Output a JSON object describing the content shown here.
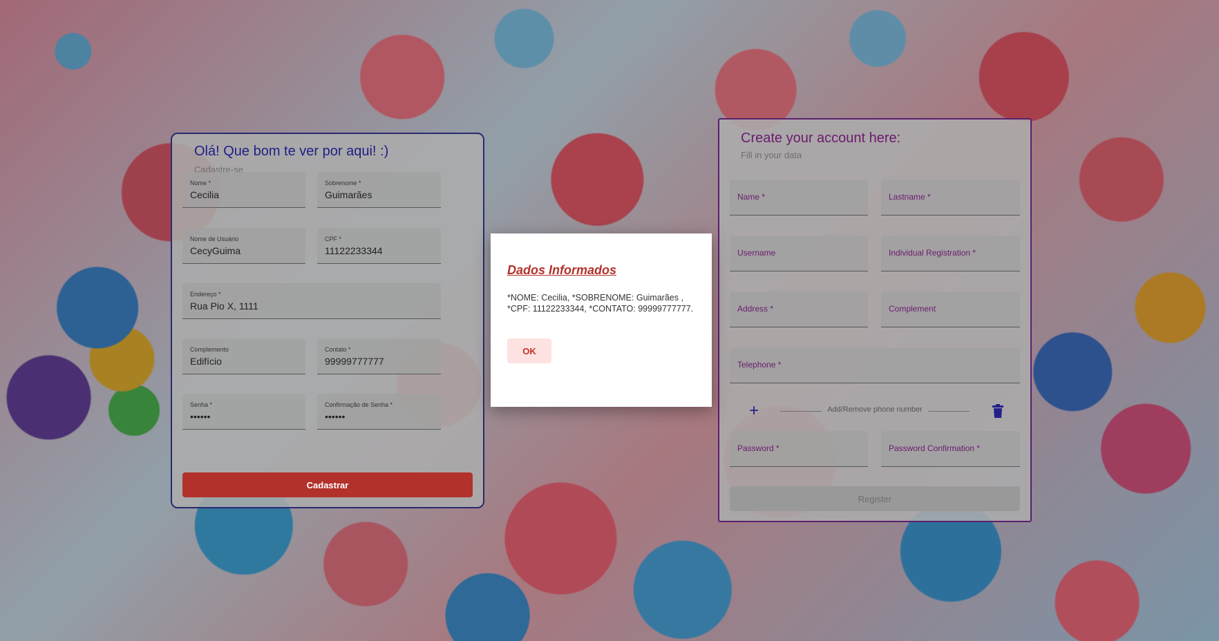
{
  "pt_form": {
    "title": "Olá! Que bom te ver por aqui! :)",
    "subtitle": "Cadastre-se",
    "fields": {
      "nome": {
        "label": "Nome *",
        "value": "Cecilia"
      },
      "sobrenome": {
        "label": "Sobrenome *",
        "value": "Guimarães"
      },
      "usuario": {
        "label": "Nome de Usuário",
        "value": "CecyGuima"
      },
      "cpf": {
        "label": "CPF *",
        "value": "11122233344"
      },
      "endereco": {
        "label": "Endereço *",
        "value": "Rua Pio X, 1111"
      },
      "complemento": {
        "label": "Complemento",
        "value": "Edifício"
      },
      "contato": {
        "label": "Contato *",
        "value": "99999777777"
      },
      "senha": {
        "label": "Senha *",
        "value": "••••••"
      },
      "confirmacao": {
        "label": "Confirmação de Senha *",
        "value": "••••••"
      }
    },
    "submit_label": "Cadastrar"
  },
  "en_form": {
    "title": "Create your account here:",
    "subtitle": "Fill in your data",
    "fields": {
      "name": {
        "placeholder": "Name *"
      },
      "lastname": {
        "placeholder": "Lastname *"
      },
      "username": {
        "placeholder": "Username"
      },
      "registration": {
        "placeholder": "Individual Registration *"
      },
      "address": {
        "placeholder": "Address *"
      },
      "complement": {
        "placeholder": "Complement"
      },
      "telephone": {
        "placeholder": "Telephone *"
      },
      "password": {
        "placeholder": "Password *"
      },
      "password_confirmation": {
        "placeholder": "Password Confirmation *"
      }
    },
    "phone_row_label": "Add/Remove phone number",
    "submit_label": "Register"
  },
  "dialog": {
    "title": "Dados Informados",
    "message": "*NOME: Cecilia, *SOBRENOME: Guimarães , *CPF: 11122233344, *CONTATO: 99999777777.",
    "ok_label": "OK"
  },
  "colors": {
    "accent_red": "#b2312b",
    "title_blue": "#1f1f86",
    "title_purple": "#6a1b6e"
  }
}
